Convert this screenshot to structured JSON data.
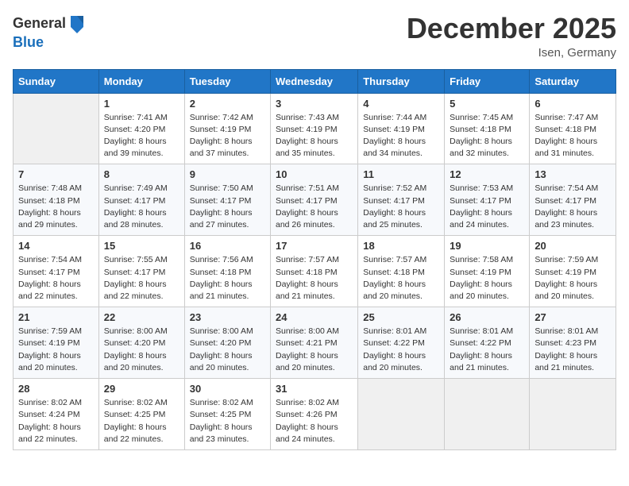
{
  "logo": {
    "general": "General",
    "blue": "Blue"
  },
  "title": {
    "month": "December 2025",
    "location": "Isen, Germany"
  },
  "weekdays": [
    "Sunday",
    "Monday",
    "Tuesday",
    "Wednesday",
    "Thursday",
    "Friday",
    "Saturday"
  ],
  "weeks": [
    [
      {
        "day": "",
        "info": ""
      },
      {
        "day": "1",
        "info": "Sunrise: 7:41 AM\nSunset: 4:20 PM\nDaylight: 8 hours\nand 39 minutes."
      },
      {
        "day": "2",
        "info": "Sunrise: 7:42 AM\nSunset: 4:19 PM\nDaylight: 8 hours\nand 37 minutes."
      },
      {
        "day": "3",
        "info": "Sunrise: 7:43 AM\nSunset: 4:19 PM\nDaylight: 8 hours\nand 35 minutes."
      },
      {
        "day": "4",
        "info": "Sunrise: 7:44 AM\nSunset: 4:19 PM\nDaylight: 8 hours\nand 34 minutes."
      },
      {
        "day": "5",
        "info": "Sunrise: 7:45 AM\nSunset: 4:18 PM\nDaylight: 8 hours\nand 32 minutes."
      },
      {
        "day": "6",
        "info": "Sunrise: 7:47 AM\nSunset: 4:18 PM\nDaylight: 8 hours\nand 31 minutes."
      }
    ],
    [
      {
        "day": "7",
        "info": "Sunrise: 7:48 AM\nSunset: 4:18 PM\nDaylight: 8 hours\nand 29 minutes."
      },
      {
        "day": "8",
        "info": "Sunrise: 7:49 AM\nSunset: 4:17 PM\nDaylight: 8 hours\nand 28 minutes."
      },
      {
        "day": "9",
        "info": "Sunrise: 7:50 AM\nSunset: 4:17 PM\nDaylight: 8 hours\nand 27 minutes."
      },
      {
        "day": "10",
        "info": "Sunrise: 7:51 AM\nSunset: 4:17 PM\nDaylight: 8 hours\nand 26 minutes."
      },
      {
        "day": "11",
        "info": "Sunrise: 7:52 AM\nSunset: 4:17 PM\nDaylight: 8 hours\nand 25 minutes."
      },
      {
        "day": "12",
        "info": "Sunrise: 7:53 AM\nSunset: 4:17 PM\nDaylight: 8 hours\nand 24 minutes."
      },
      {
        "day": "13",
        "info": "Sunrise: 7:54 AM\nSunset: 4:17 PM\nDaylight: 8 hours\nand 23 minutes."
      }
    ],
    [
      {
        "day": "14",
        "info": "Sunrise: 7:54 AM\nSunset: 4:17 PM\nDaylight: 8 hours\nand 22 minutes."
      },
      {
        "day": "15",
        "info": "Sunrise: 7:55 AM\nSunset: 4:17 PM\nDaylight: 8 hours\nand 22 minutes."
      },
      {
        "day": "16",
        "info": "Sunrise: 7:56 AM\nSunset: 4:18 PM\nDaylight: 8 hours\nand 21 minutes."
      },
      {
        "day": "17",
        "info": "Sunrise: 7:57 AM\nSunset: 4:18 PM\nDaylight: 8 hours\nand 21 minutes."
      },
      {
        "day": "18",
        "info": "Sunrise: 7:57 AM\nSunset: 4:18 PM\nDaylight: 8 hours\nand 20 minutes."
      },
      {
        "day": "19",
        "info": "Sunrise: 7:58 AM\nSunset: 4:19 PM\nDaylight: 8 hours\nand 20 minutes."
      },
      {
        "day": "20",
        "info": "Sunrise: 7:59 AM\nSunset: 4:19 PM\nDaylight: 8 hours\nand 20 minutes."
      }
    ],
    [
      {
        "day": "21",
        "info": "Sunrise: 7:59 AM\nSunset: 4:19 PM\nDaylight: 8 hours\nand 20 minutes."
      },
      {
        "day": "22",
        "info": "Sunrise: 8:00 AM\nSunset: 4:20 PM\nDaylight: 8 hours\nand 20 minutes."
      },
      {
        "day": "23",
        "info": "Sunrise: 8:00 AM\nSunset: 4:20 PM\nDaylight: 8 hours\nand 20 minutes."
      },
      {
        "day": "24",
        "info": "Sunrise: 8:00 AM\nSunset: 4:21 PM\nDaylight: 8 hours\nand 20 minutes."
      },
      {
        "day": "25",
        "info": "Sunrise: 8:01 AM\nSunset: 4:22 PM\nDaylight: 8 hours\nand 20 minutes."
      },
      {
        "day": "26",
        "info": "Sunrise: 8:01 AM\nSunset: 4:22 PM\nDaylight: 8 hours\nand 21 minutes."
      },
      {
        "day": "27",
        "info": "Sunrise: 8:01 AM\nSunset: 4:23 PM\nDaylight: 8 hours\nand 21 minutes."
      }
    ],
    [
      {
        "day": "28",
        "info": "Sunrise: 8:02 AM\nSunset: 4:24 PM\nDaylight: 8 hours\nand 22 minutes."
      },
      {
        "day": "29",
        "info": "Sunrise: 8:02 AM\nSunset: 4:25 PM\nDaylight: 8 hours\nand 22 minutes."
      },
      {
        "day": "30",
        "info": "Sunrise: 8:02 AM\nSunset: 4:25 PM\nDaylight: 8 hours\nand 23 minutes."
      },
      {
        "day": "31",
        "info": "Sunrise: 8:02 AM\nSunset: 4:26 PM\nDaylight: 8 hours\nand 24 minutes."
      },
      {
        "day": "",
        "info": ""
      },
      {
        "day": "",
        "info": ""
      },
      {
        "day": "",
        "info": ""
      }
    ]
  ]
}
